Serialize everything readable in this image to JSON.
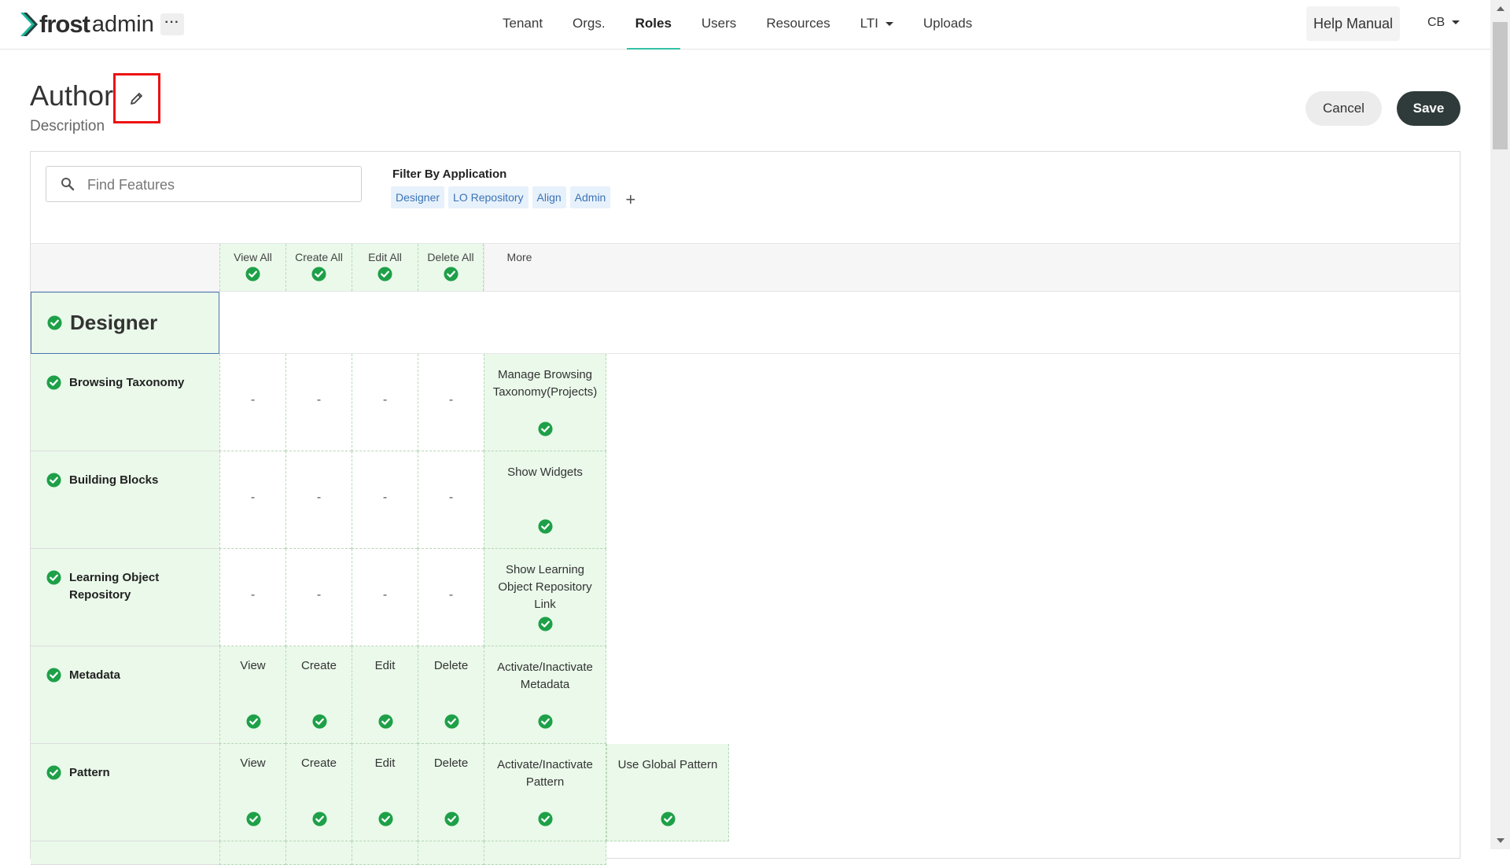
{
  "app": {
    "logo_brand": "frost",
    "logo_suffix": "admin",
    "more_label": "···"
  },
  "nav": {
    "items": [
      {
        "label": "Tenant",
        "active": false
      },
      {
        "label": "Orgs.",
        "active": false
      },
      {
        "label": "Roles",
        "active": true
      },
      {
        "label": "Users",
        "active": false
      },
      {
        "label": "Resources",
        "active": false
      },
      {
        "label": "LTI",
        "active": false,
        "dropdown": true
      },
      {
        "label": "Uploads",
        "active": false
      }
    ],
    "help_label": "Help Manual",
    "user_initials": "CB"
  },
  "role": {
    "title": "Author",
    "description": "Description",
    "cancel_label": "Cancel",
    "save_label": "Save"
  },
  "filters": {
    "search_placeholder": "Find Features",
    "filter_label": "Filter By Application",
    "chips": [
      "Designer",
      "LO Repository",
      "Align",
      "Admin"
    ],
    "add_label": "+"
  },
  "table": {
    "headers": [
      "View All",
      "Create All",
      "Edit All",
      "Delete All",
      "More"
    ],
    "group": "Designer",
    "rows": [
      {
        "feature": "Browsing Taxonomy",
        "crud": [
          "-",
          "-",
          "-",
          "-"
        ],
        "extra": [
          "Manage Browsing Taxonomy(Projects)"
        ]
      },
      {
        "feature": "Building Blocks",
        "crud": [
          "-",
          "-",
          "-",
          "-"
        ],
        "extra": [
          "Show Widgets"
        ]
      },
      {
        "feature": "Learning Object Repository",
        "crud": [
          "-",
          "-",
          "-",
          "-"
        ],
        "extra": [
          "Show Learning Object Repository Link"
        ]
      },
      {
        "feature": "Metadata",
        "crud": [
          "View",
          "Create",
          "Edit",
          "Delete"
        ],
        "extra": [
          "Activate/Inactivate Metadata"
        ]
      },
      {
        "feature": "Pattern",
        "crud": [
          "View",
          "Create",
          "Edit",
          "Delete"
        ],
        "extra": [
          "Activate/Inactivate Pattern",
          "Use Global Pattern"
        ]
      }
    ]
  },
  "colors": {
    "accent": "#33c1a5",
    "check_green": "#1ea048",
    "cell_green": "#eaf9ea",
    "save_dark": "#2f3b3a",
    "chip_bg": "#e7f1fb",
    "chip_text": "#3b73b5",
    "highlight_red": "#ee1111"
  }
}
